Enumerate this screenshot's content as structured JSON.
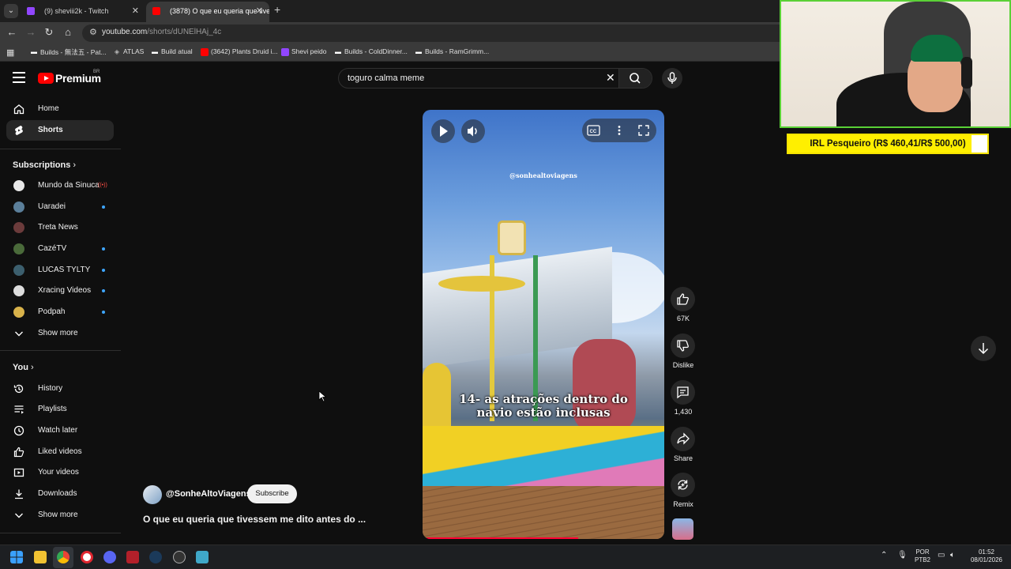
{
  "browser": {
    "tabs": [
      {
        "title": "(9) sheviii2k - Twitch",
        "active": false
      },
      {
        "title": "(3878) O que eu queria que tive...",
        "active": true
      }
    ],
    "new_tab": "+",
    "url_host": "youtube.com",
    "url_path": "/shorts/dUNElHAj_4c",
    "bookmarks": [
      "Builds - 無法五 - Pat...",
      "ATLAS",
      "Build atual",
      "(3642) Plants Druid i...",
      "Shevi peido",
      "Builds - ColdDinner...",
      "Builds - RamGrimm..."
    ]
  },
  "youtube": {
    "brand": "Premium",
    "country": "BR",
    "search_query": "toguro calma meme",
    "nav": [
      {
        "label": "Home",
        "icon": "home-icon"
      },
      {
        "label": "Shorts",
        "icon": "shorts-icon"
      }
    ],
    "subscriptions_title": "Subscriptions",
    "subscriptions": [
      {
        "label": "Mundo da Sinuca",
        "status": "live",
        "color": "#e8e8e8"
      },
      {
        "label": "Uaradei",
        "status": "new",
        "color": "#5b7f9a"
      },
      {
        "label": "Treta News",
        "status": "",
        "color": "#6b3b3b"
      },
      {
        "label": "CazéTV",
        "status": "new",
        "color": "#4a6a3a"
      },
      {
        "label": "LUCAS TYLTY",
        "status": "new",
        "color": "#3c5f6e"
      },
      {
        "label": "Xracing Videos",
        "status": "new",
        "color": "#dcdcdc"
      },
      {
        "label": "Podpah",
        "status": "new",
        "color": "#d8b24a"
      }
    ],
    "show_more": "Show more",
    "you_title": "You",
    "you_items": [
      {
        "label": "History",
        "icon": "history-icon"
      },
      {
        "label": "Playlists",
        "icon": "playlists-icon"
      },
      {
        "label": "Watch later",
        "icon": "watch-later-icon"
      },
      {
        "label": "Liked videos",
        "icon": "liked-icon"
      },
      {
        "label": "Your videos",
        "icon": "your-videos-icon"
      },
      {
        "label": "Downloads",
        "icon": "downloads-icon"
      }
    ],
    "short": {
      "watermark": "@sonhealtoviagens",
      "caption_line1": "14- as atrações dentro do",
      "caption_line2": "navio estão inclusas",
      "channel": "@SonheAltoViagens",
      "subscribe": "Subscribe",
      "title": "O que eu queria que tivessem me dito antes do ...",
      "progress_fraction": 0.65
    },
    "actions": [
      {
        "icon": "like-icon",
        "label": "67K"
      },
      {
        "icon": "dislike-icon",
        "label": "Dislike"
      },
      {
        "icon": "comments-icon",
        "label": "1,430"
      },
      {
        "icon": "share-icon",
        "label": "Share"
      },
      {
        "icon": "remix-icon",
        "label": "Remix"
      }
    ]
  },
  "overlay": {
    "goal_text": "IRL Pesqueiro (R$ 460,41/R$ 500,00)",
    "goal_fraction": 0.92
  },
  "taskbar": {
    "lang1": "POR",
    "lang2": "PTB2",
    "time": "01:52",
    "date": "08/01/2026"
  },
  "colors": {
    "accent": "#ff0000",
    "background": "#0f0f0f",
    "goal_yellow": "#ffef00",
    "cam_border": "#5ad136"
  }
}
